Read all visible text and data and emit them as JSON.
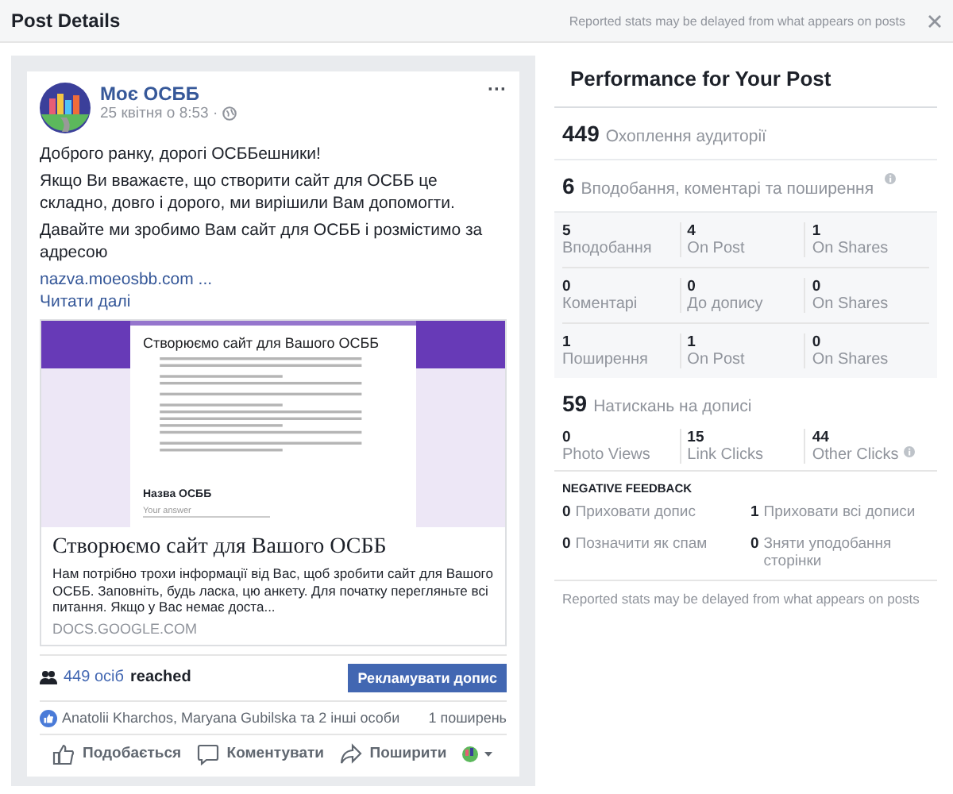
{
  "window": {
    "title": "Post Details",
    "notice": "Reported stats may be delayed from what appears on posts"
  },
  "post": {
    "page_name": "Моє ОСББ",
    "timestamp": "25 квітня о 8:53 ·",
    "more": "···",
    "paragraphs": [
      "Доброго ранку, дорогі ОСББешники!",
      "Якщо Ви вважаєте, що створити сайт для ОСББ це складно, довго і дорого, ми вирішили Вам допомогти.",
      "Давайте ми зробимо Вам сайт для ОСББ і розмістимо за адресою"
    ],
    "link_text": "nazva.moeosbb.com ...",
    "read_more": "Читати далі",
    "preview": {
      "form_title": "Створюємо сайт для Вашого ОСББ",
      "form_question": "Назва ОСББ",
      "form_placeholder": "Your answer",
      "title": "Створюємо сайт для Вашого ОСББ",
      "description": "Нам потрібно трохи інформації від Вас, щоб зробити сайт для Вашого ОСББ. Заповніть, будь ласка, цю анкету. Для початку перегляньте всі питання. Якщо у Вас немає доста...",
      "domain": "DOCS.GOOGLE.COM"
    },
    "reach_count": "449 осіб",
    "reach_label": "reached",
    "boost_button": "Рекламувати допис",
    "reactions": "Anatolii Kharchos, Maryana Gubilska та 2 інші особи",
    "shares": "1 поширень",
    "actions": [
      {
        "kind": "like",
        "label": "Подобається"
      },
      {
        "kind": "comment",
        "label": "Коментувати"
      },
      {
        "kind": "share",
        "label": "Поширити"
      }
    ]
  },
  "performance": {
    "title": "Performance for Your Post",
    "reach": {
      "value": "449",
      "label": "Охоплення аудиторії"
    },
    "engagement": {
      "value": "6",
      "label": "Вподобання, коментарі та поширення"
    },
    "engagement_rows": [
      [
        {
          "value": "5",
          "label": "Вподобання"
        },
        {
          "value": "4",
          "label": "On Post"
        },
        {
          "value": "1",
          "label": "On Shares"
        }
      ],
      [
        {
          "value": "0",
          "label": "Коментарі"
        },
        {
          "value": "0",
          "label": "До допису"
        },
        {
          "value": "0",
          "label": "On Shares"
        }
      ],
      [
        {
          "value": "1",
          "label": "Поширення"
        },
        {
          "value": "1",
          "label": "On Post"
        },
        {
          "value": "0",
          "label": "On Shares"
        }
      ]
    ],
    "clicks": {
      "value": "59",
      "label": "Натискань на дописі"
    },
    "click_items": [
      {
        "value": "0",
        "label": "Photo Views"
      },
      {
        "value": "15",
        "label": "Link Clicks"
      },
      {
        "value": "44",
        "label": "Other Clicks"
      }
    ],
    "negative": {
      "title": "NEGATIVE FEEDBACK",
      "items": [
        {
          "value": "0",
          "label": "Приховати допис"
        },
        {
          "value": "1",
          "label": "Приховати всі дописи"
        },
        {
          "value": "0",
          "label": "Позначити як спам"
        },
        {
          "value": "0",
          "label": "Зняти уподобання сторінки"
        }
      ]
    },
    "footnote": "Reported stats may be delayed from what appears on posts"
  }
}
